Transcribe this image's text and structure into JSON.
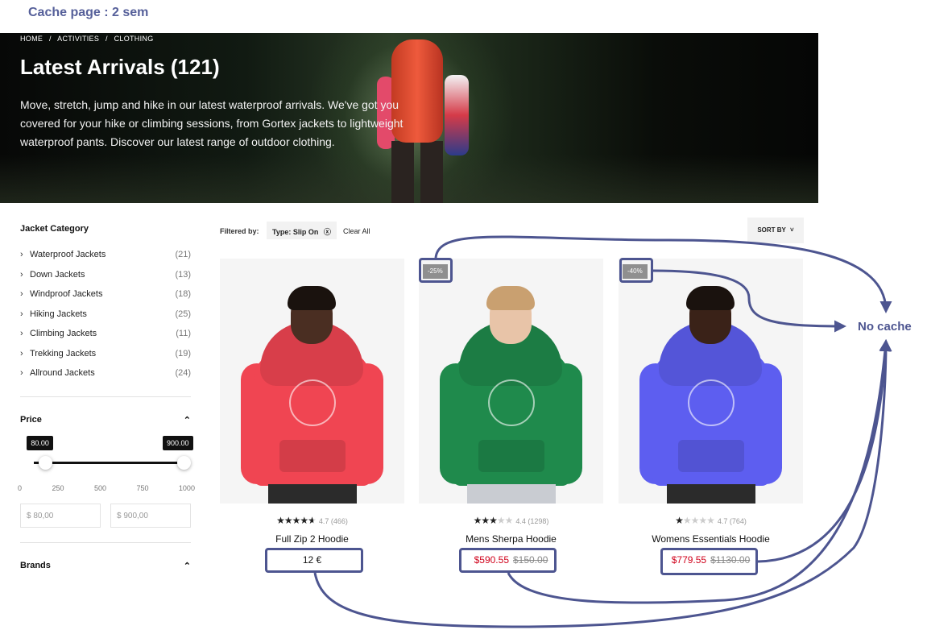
{
  "annotations": {
    "cache_note": "Cache page : 2 sem",
    "no_cache_label": "No cache",
    "color": "#4d5590"
  },
  "breadcrumb": {
    "items": [
      "HOME",
      "ACTIVITIES",
      "CLOTHING"
    ],
    "separator": "/"
  },
  "hero": {
    "title": "Latest Arrivals (121)",
    "description": "Move, stretch, jump and hike in our latest waterproof arrivals. We've got you covered for your hike or climbing sessions, from Gortex jackets to lightweight waterproof pants. Discover our latest range of outdoor clothing."
  },
  "sidebar": {
    "category_title": "Jacket Category",
    "categories": [
      {
        "label": "Waterproof Jackets",
        "count": "(21)"
      },
      {
        "label": "Down Jackets",
        "count": "(13)"
      },
      {
        "label": "Windproof Jackets",
        "count": "(18)"
      },
      {
        "label": "Hiking Jackets",
        "count": "(25)"
      },
      {
        "label": "Climbing Jackets",
        "count": "(11)"
      },
      {
        "label": "Trekking Jackets",
        "count": "(19)"
      },
      {
        "label": "Allround Jackets",
        "count": "(24)"
      }
    ],
    "price_title": "Price",
    "price_min_tag": "80.00",
    "price_max_tag": "900.00",
    "price_min_fraction": 0.08,
    "price_max_fraction": 0.9,
    "ticks": [
      "0",
      "250",
      "500",
      "750",
      "1000"
    ],
    "min_input": "$   80,00",
    "max_input": "$   900,00",
    "brands_title": "Brands"
  },
  "filters": {
    "label": "Filtered by:",
    "chip": "Type: Slip On",
    "clear": "Clear All",
    "sort": "SORT BY"
  },
  "products": [
    {
      "name": "Full Zip 2 Hoodie",
      "stars": "★★★★★",
      "rating_text": "4.7 (466)",
      "price": "12 €",
      "sale_price": "",
      "orig_price": "",
      "badge": "",
      "hoodie_color": "#f04552",
      "skin_color": "#4a2e22"
    },
    {
      "name": "Mens Sherpa Hoodie",
      "stars": "★★★★★",
      "rating_text": "4.4 (1298)",
      "price": "",
      "sale_price": "$590.55",
      "orig_price": "$150.00",
      "badge": "-25%",
      "hoodie_color": "#1f8a4c",
      "skin_color": "#e8c4a8"
    },
    {
      "name": "Womens Essentials Hoodie",
      "stars": "★★★★★",
      "rating_text": "4.7 (764)",
      "price": "",
      "sale_price": "$779.55",
      "orig_price": "$1130.00",
      "badge": "-40%",
      "hoodie_color": "#5d5ef0",
      "skin_color": "#3a2218"
    }
  ]
}
